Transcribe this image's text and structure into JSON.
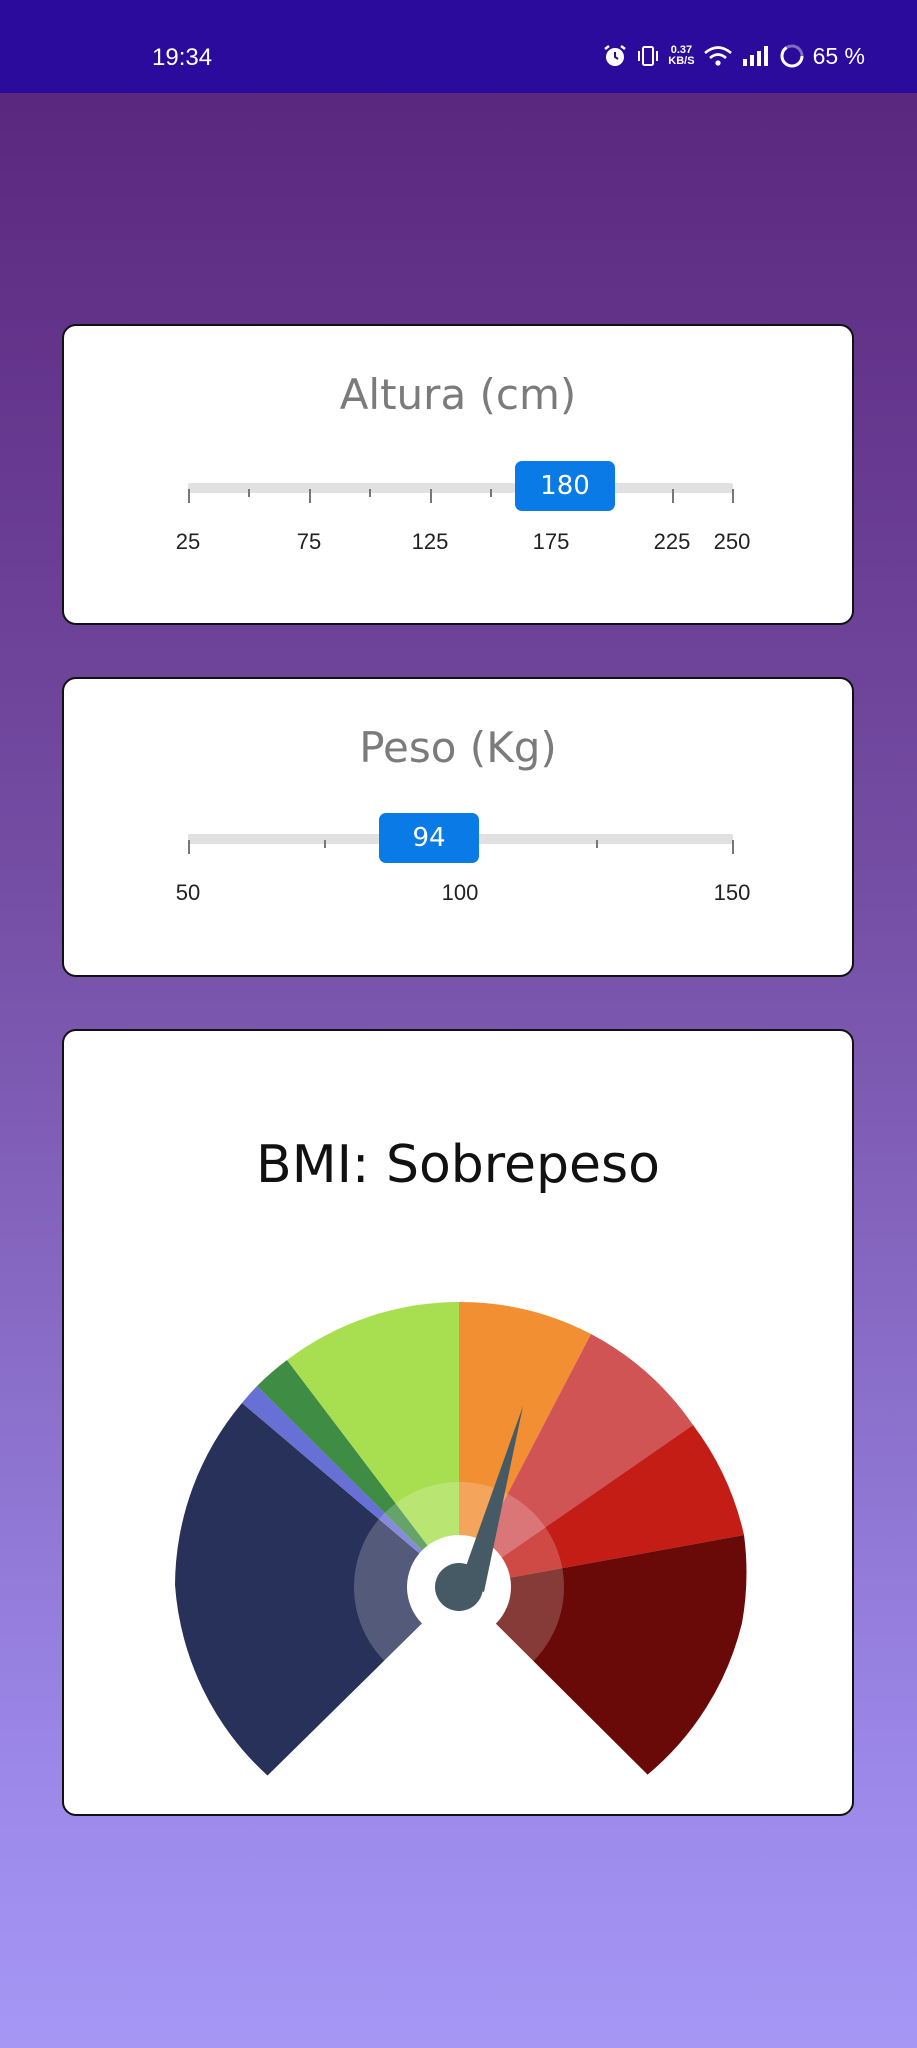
{
  "status": {
    "time": "19:34",
    "speed_value": "0.37",
    "speed_unit": "KB/S",
    "battery": "65 %"
  },
  "height_slider": {
    "title": "Altura (cm)",
    "value": 180,
    "min": 25,
    "max": 250,
    "labels": [
      "25",
      "75",
      "125",
      "175",
      "225",
      "250"
    ]
  },
  "weight_slider": {
    "title": "Peso (Kg)",
    "value": 94,
    "min": 50,
    "max": 150,
    "labels": [
      "50",
      "100",
      "150"
    ]
  },
  "bmi": {
    "title": "BMI: Sobrepeso",
    "colors": {
      "very_severely_underweight": "#283159",
      "severely_underweight": "#6770d4",
      "underweight": "#3f8c44",
      "normal": "#a8df50",
      "overweight": "#f28f32",
      "obese_1": "#d15455",
      "obese_2": "#c31d16",
      "obese_3": "#690a08",
      "needle": "#455a64"
    }
  },
  "colors": {
    "accent": "#0a7ae6",
    "statusbar": "#2a0b9c"
  }
}
